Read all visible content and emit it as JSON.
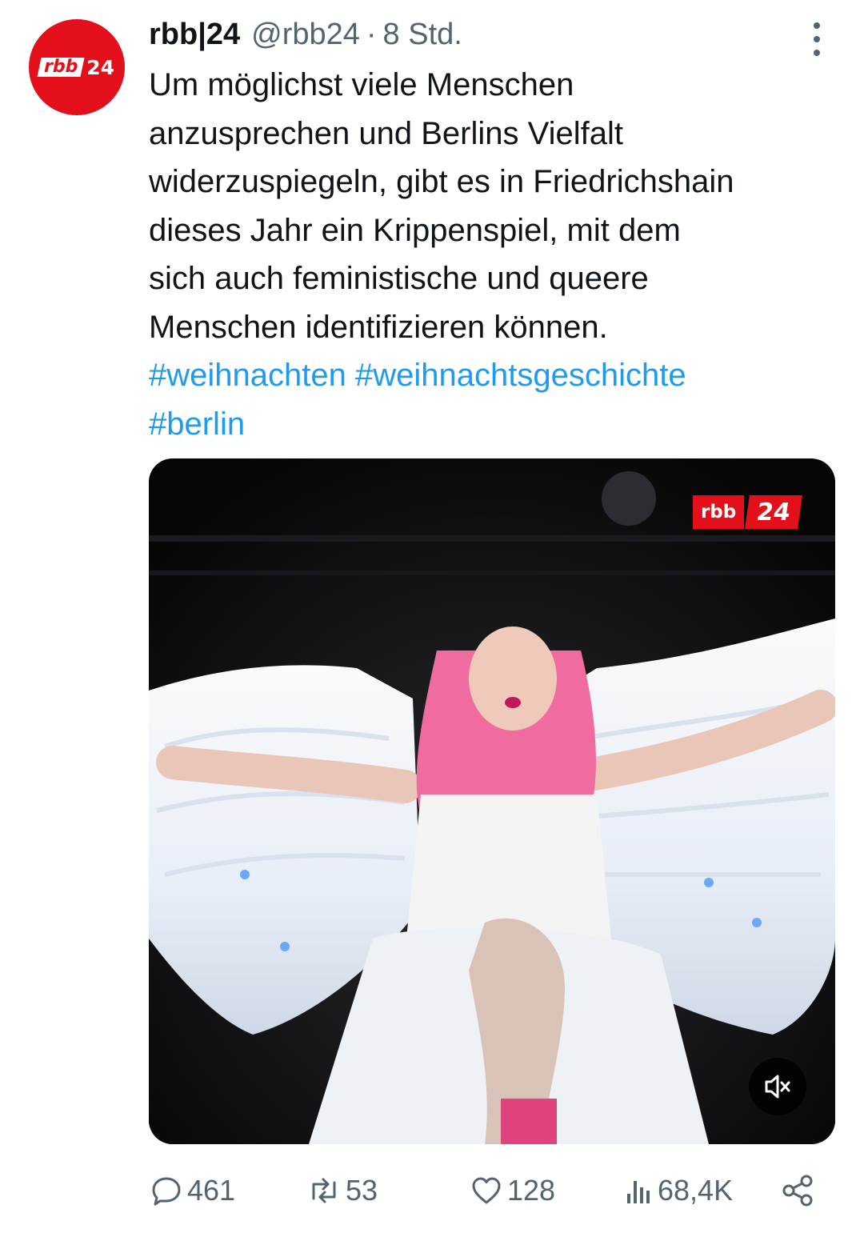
{
  "tweet": {
    "account_name": "rbb|24",
    "handle": "@rbb24",
    "separator": "·",
    "time": "8 Std.",
    "avatar": {
      "brand_left": "rbb",
      "brand_right": "24",
      "color": "#e3101b"
    },
    "text_lines": [
      "Um möglichst viele Menschen",
      "anzusprechen und Berlins Vielfalt",
      "widerzuspiegeln, gibt es in Friedrichshain",
      "dieses Jahr ein Krippenspiel, mit dem",
      "sich auch feministische und queere",
      "Menschen identifizieren können."
    ],
    "hashtags": [
      "#weihnachten",
      "#weihnachtsgeschichte",
      "#berlin"
    ],
    "media": {
      "type": "video",
      "watermark_left": "rbb",
      "watermark_right": "24",
      "sound_icon": "speaker-muted-icon"
    },
    "actions": {
      "replies": "461",
      "reposts": "53",
      "likes": "128",
      "views": "68,4K"
    }
  },
  "colors": {
    "link": "#1d9bf0",
    "muted": "#536471",
    "brand": "#e3101b"
  }
}
